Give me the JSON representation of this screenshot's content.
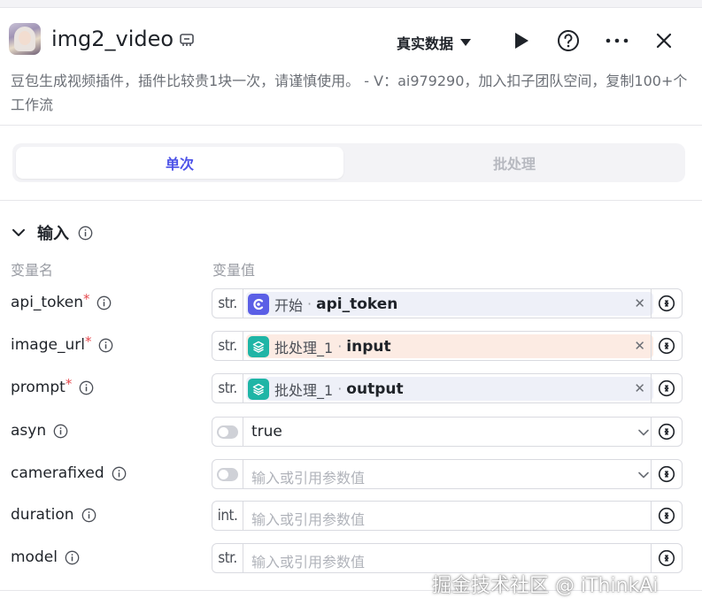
{
  "header": {
    "title": "img2_video",
    "mode_label": "真实数据",
    "description": "豆包生成视频插件，插件比较贵1块一次，请谨慎使用。 - V：ai979290，加入扣子团队空间，复制100+个工作流"
  },
  "tabs": [
    {
      "label": "单次",
      "active": true
    },
    {
      "label": "批处理",
      "active": false
    }
  ],
  "input_section": {
    "title": "输入",
    "col_name": "变量名",
    "col_value": "变量值",
    "params": [
      {
        "name": "api_token",
        "required": true,
        "type": "str.",
        "kind": "ref",
        "ref_source": "开始",
        "ref_var": "api_token",
        "chip_color": "blue",
        "icon": "start-node-icon"
      },
      {
        "name": "image_url",
        "required": true,
        "type": "str.",
        "kind": "ref",
        "ref_source": "批处理_1",
        "ref_var": "input",
        "chip_color": "orange",
        "icon": "batch-node-icon"
      },
      {
        "name": "prompt",
        "required": true,
        "type": "str.",
        "kind": "ref",
        "ref_source": "批处理_1",
        "ref_var": "output",
        "chip_color": "blue",
        "icon": "batch-node-icon"
      },
      {
        "name": "asyn",
        "required": false,
        "type": "toggle",
        "kind": "select",
        "value": "true"
      },
      {
        "name": "camerafixed",
        "required": false,
        "type": "toggle",
        "kind": "select",
        "placeholder": "输入或引用参数值"
      },
      {
        "name": "duration",
        "required": false,
        "type": "int.",
        "kind": "text",
        "placeholder": "输入或引用参数值"
      },
      {
        "name": "model",
        "required": false,
        "type": "str.",
        "kind": "text",
        "placeholder": "输入或引用参数值"
      }
    ]
  },
  "watermark": "掘金技术社区 @ iThinkAi",
  "colors": {
    "accent": "#4d53e8",
    "start_node": "#5b5fe6",
    "batch_node": "#1fb5a6",
    "required": "#e5484d"
  }
}
